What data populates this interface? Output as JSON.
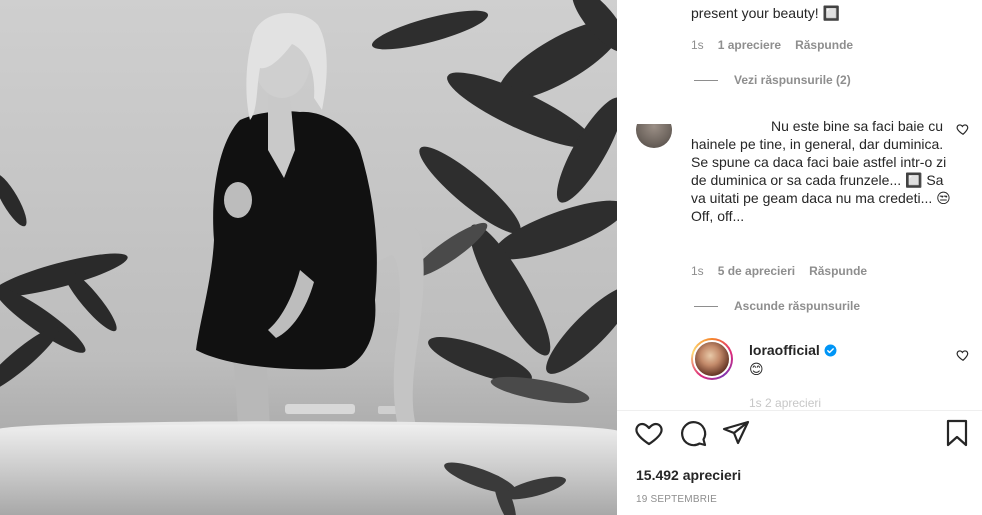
{
  "post": {
    "likes_text": "15.492 aprecieri",
    "date_text": "19 SEPTEMBRIE",
    "image_alt": "Black and white photo of a woman in a dark shirt stepping into a bathtub among tropical plants"
  },
  "comments": {
    "first": {
      "text_tail": "present your beauty! 🔲",
      "time": "1s",
      "likes": "1 apreciere",
      "reply_label": "Răspunde",
      "view_replies": "Vezi răspunsurile (2)"
    },
    "second": {
      "text": "Nu este bine sa faci baie cu hainele pe tine, in general, dar duminica. Se spune ca daca faci baie astfel intr-o zi de duminica or sa cada frunzele... 🔲 Sa va uitati pe geam daca nu ma credeti... 😒 Off, off...",
      "time": "1s",
      "likes": "5 de aprecieri",
      "reply_label": "Răspunde",
      "hide_replies": "Ascunde răspunsurile"
    },
    "reply": {
      "username": "loraofficial",
      "text": "😊",
      "partial_meta": "1s   2 aprecieri"
    }
  },
  "icons": {
    "like": "heart-outline-icon",
    "comment": "speech-bubble-icon",
    "share": "paper-plane-icon",
    "save": "bookmark-icon",
    "comment_like": "heart-small-icon",
    "verified": "verified-badge-icon"
  },
  "colors": {
    "text": "#262626",
    "secondary": "#8e8e8e",
    "verified": "#0095f6",
    "divider": "#efefef"
  }
}
